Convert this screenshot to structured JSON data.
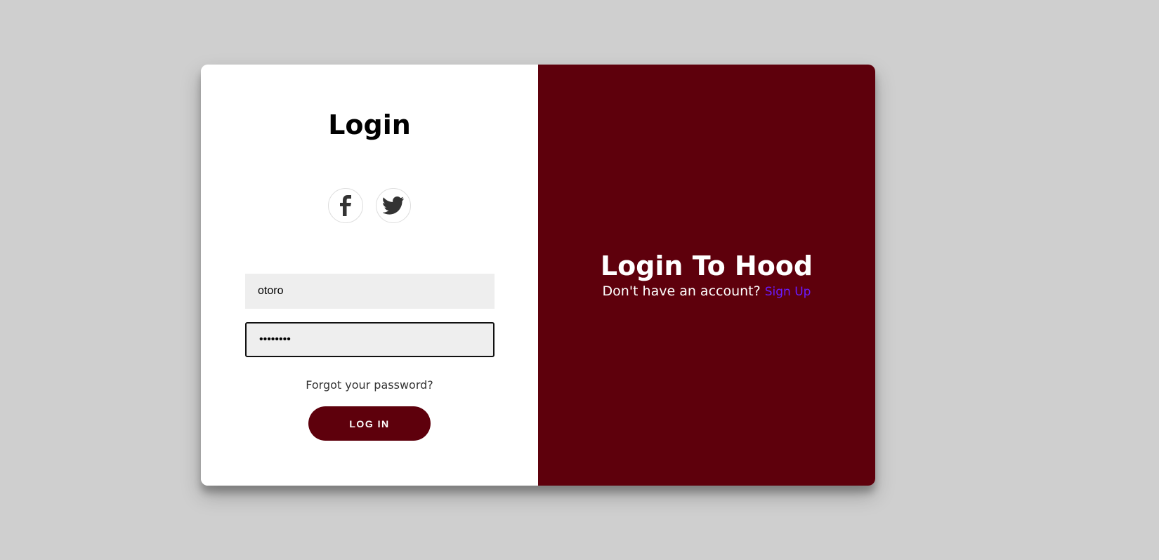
{
  "login_panel": {
    "title": "Login",
    "social": {
      "facebook_icon": "facebook-icon",
      "twitter_icon": "twitter-icon"
    },
    "username": {
      "value": "otoro"
    },
    "password": {
      "value": "••••••••"
    },
    "forgot_password": "Forgot your password?",
    "login_button": "LOG IN"
  },
  "overlay_panel": {
    "title": "Login To Hood",
    "prompt": "Don't have an account?",
    "signup_link": "Sign Up"
  },
  "colors": {
    "page_background": "#cfcfcf",
    "brand": "#5e000c",
    "signup_link": "#6a1bff",
    "input_background": "#eeeeee"
  }
}
